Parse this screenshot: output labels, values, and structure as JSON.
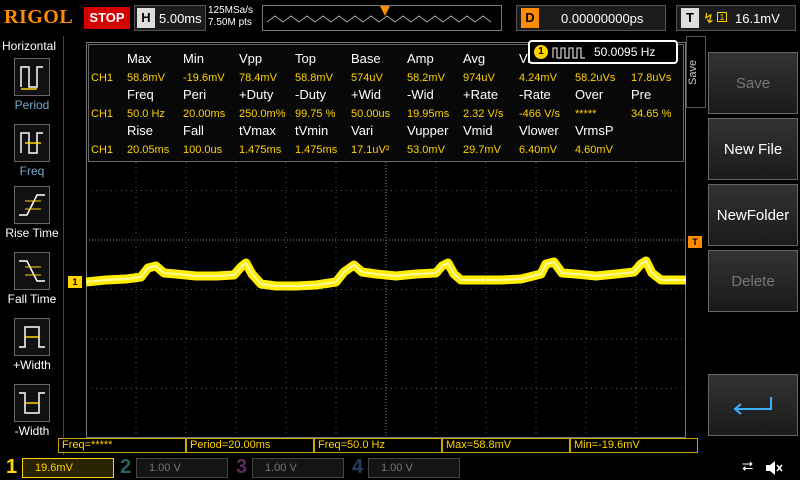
{
  "top": {
    "brand": "RIGOL",
    "status": "STOP",
    "h_key": "H",
    "timebase": "5.00ms",
    "sample_rate": "125MSa/s",
    "points": "7.50M pts",
    "trig_marker": "T",
    "delay_key": "D",
    "delay": "0.00000000ps",
    "trig_key": "T",
    "trig_level": "16.1mV"
  },
  "left": {
    "title": "Horizontal",
    "items": [
      "Period",
      "Freq",
      "Rise Time",
      "Fall Time",
      "+Width",
      "-Width"
    ]
  },
  "right": {
    "tab": "Save",
    "buttons": [
      "Save",
      "New File",
      "NewFolder",
      "Delete"
    ],
    "enter_icon": "enter-arrow-icon"
  },
  "freq_counter": {
    "channel": "1",
    "value": "50.0095 Hz"
  },
  "measure": {
    "row1_headers": [
      "Max",
      "Min",
      "Vpp",
      "Top",
      "Base",
      "Amp",
      "Avg",
      "Vr",
      "",
      ""
    ],
    "row1_values": [
      "58.8mV",
      "-19.6mV",
      "78.4mV",
      "58.8mV",
      "574uV",
      "58.2mV",
      "974uV",
      "4.24mV",
      "58.2uVs",
      "17.8uVs"
    ],
    "row2_headers": [
      "Freq",
      "Peri",
      "+Duty",
      "-Duty",
      "+Wid",
      "-Wid",
      "+Rate",
      "-Rate",
      "Over",
      "Pre"
    ],
    "row2_values": [
      "50.0 Hz",
      "20.00ms",
      "250.0m%",
      "99.75 %",
      "50.00us",
      "19.95ms",
      "2.32 V/s",
      "-466 V/s",
      "*****",
      "34.65 %"
    ],
    "row3_headers": [
      "Rise",
      "Fall",
      "tVmax",
      "tVmin",
      "Vari",
      "Vupper",
      "Vmid",
      "Vlower",
      "VrmsP"
    ],
    "row3_values": [
      "20.05ms",
      "100.0us",
      "1.475ms",
      "1.475ms",
      "17.1uV²",
      "53.0mV",
      "29.7mV",
      "6.40mV",
      "4.60mV"
    ],
    "ch_label": "CH1"
  },
  "status_bar": [
    "Freq=*****",
    "Period=20.00ms",
    "Freq=50.0 Hz",
    "Max=58.8mV",
    "Min=-19.6mV"
  ],
  "channels": [
    {
      "num": "1",
      "scale": "19.6mV",
      "color": "#ffd200",
      "active": true
    },
    {
      "num": "2",
      "scale": "1.00 V",
      "color": "#2a9db5",
      "active": false
    },
    {
      "num": "3",
      "scale": "1.00 V",
      "color": "#c030c0",
      "active": false
    },
    {
      "num": "4",
      "scale": "1.00 V",
      "color": "#3070c0",
      "active": false
    }
  ],
  "markers": {
    "ch1": "1",
    "trig": "T"
  },
  "colors": {
    "ch1": "#ffd200",
    "accent": "#ff8c00",
    "stop": "#d40000"
  }
}
